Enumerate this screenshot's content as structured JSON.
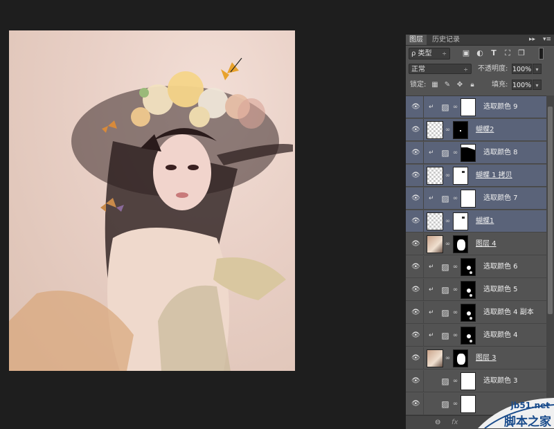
{
  "panel": {
    "tabs": [
      "图层",
      "历史记录"
    ],
    "collapse_glyph": "▸▸",
    "menu_glyph": "▾≡",
    "filter": {
      "label": "ρ 类型",
      "arrow": "÷"
    },
    "filter_icons": [
      "image-icon",
      "adjustment-icon",
      "type-icon",
      "shape-icon",
      "smart-object-icon"
    ],
    "blend": {
      "mode": "正常",
      "opacity_label": "不透明度:",
      "opacity_value": "100%"
    },
    "lock": {
      "label": "锁定:",
      "fill_label": "填充:",
      "fill_value": "100%"
    }
  },
  "layers": [
    {
      "name": "选取颜色 9",
      "kind": "adjustment",
      "clipped": true,
      "selected": true,
      "mask": "white"
    },
    {
      "name": "蝴蝶2",
      "kind": "smart",
      "clipped": false,
      "selected": true,
      "mask": "black"
    },
    {
      "name": "选取颜色 8",
      "kind": "adjustment",
      "clipped": true,
      "selected": true,
      "mask": "black-corner"
    },
    {
      "name": "蝴蝶 1 拷贝",
      "kind": "smart",
      "clipped": false,
      "selected": true,
      "mask": "white-dot"
    },
    {
      "name": "选取颜色 7",
      "kind": "adjustment",
      "clipped": true,
      "selected": true,
      "mask": "white"
    },
    {
      "name": "蝴蝶1",
      "kind": "smart",
      "clipped": false,
      "selected": true,
      "mask": "white-dot"
    },
    {
      "name": "图层 4",
      "kind": "pixel",
      "clipped": false,
      "selected": false,
      "mask": "figure"
    },
    {
      "name": "选取颜色 6",
      "kind": "adjustment",
      "clipped": true,
      "selected": false,
      "mask": "black-spots"
    },
    {
      "name": "选取颜色 5",
      "kind": "adjustment",
      "clipped": true,
      "selected": false,
      "mask": "black-spots"
    },
    {
      "name": "选取颜色 4 副本",
      "kind": "adjustment",
      "clipped": true,
      "selected": false,
      "mask": "black-spots"
    },
    {
      "name": "选取颜色 4",
      "kind": "adjustment",
      "clipped": true,
      "selected": false,
      "mask": "black-spots"
    },
    {
      "name": "图层 3",
      "kind": "pixel",
      "clipped": false,
      "selected": false,
      "mask": "figure"
    },
    {
      "name": "选取颜色 3",
      "kind": "adjustment",
      "clipped": false,
      "selected": false,
      "mask": "white"
    },
    {
      "name": "",
      "kind": "adjustment",
      "clipped": false,
      "selected": false,
      "mask": "white"
    }
  ],
  "bottom": {
    "link_glyph": "⊖",
    "fx_glyph": "fx"
  },
  "watermark": {
    "url": "jb51.net",
    "site": "脚本之家"
  },
  "colors": {
    "panel": "#535353",
    "selected_row": "#5a6379",
    "canvas_bg": "#1e1e1e",
    "watermark": "#1a4c8c"
  }
}
